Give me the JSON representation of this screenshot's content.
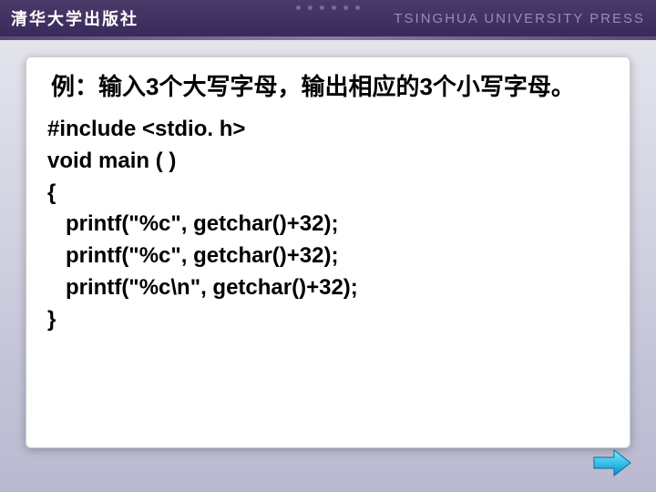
{
  "header": {
    "publisher_cn": "清华大学出版社",
    "publisher_en": "TSINGHUA UNIVERSITY PRESS"
  },
  "slide": {
    "title": "例：输入3个大写字母，输出相应的3个小写字母。",
    "code_lines": [
      "#include <stdio. h>",
      "void main ( )",
      "{",
      "   printf(\"%c\", getchar()+32);",
      "   printf(\"%c\", getchar()+32);",
      "   printf(\"%c\\n\", getchar()+32);",
      "}"
    ]
  },
  "nav": {
    "next_icon": "next-arrow-icon"
  }
}
